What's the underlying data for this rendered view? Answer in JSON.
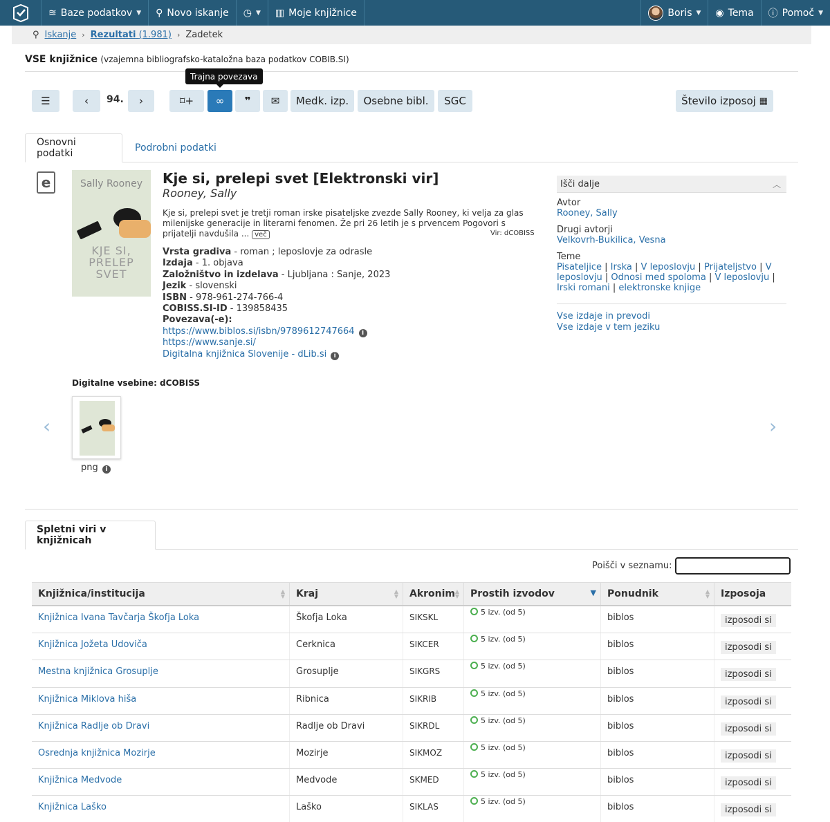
{
  "nav": {
    "databases": "Baze podatkov",
    "new_search": "Novo iskanje",
    "my_libraries": "Moje knjižnice",
    "user": "Boris",
    "theme": "Tema",
    "help": "Pomoč"
  },
  "breadcrumb": {
    "search": "Iskanje",
    "results": "Rezultati",
    "results_count": "(1.981)",
    "current": "Zadetek"
  },
  "db": {
    "name": "VSE knjižnice",
    "subtitle": "(vzajemna bibliografsko-kataložna baza podatkov COBIB.SI)"
  },
  "toolbar": {
    "position": "94.",
    "tooltip": "Trajna povezava",
    "medk": "Medk. izp.",
    "osebne": "Osebne bibl.",
    "sgc": "SGC",
    "loans": "Število izposoj"
  },
  "tabs": {
    "basic": "Osnovni podatki",
    "detailed": "Podrobni podatki",
    "online": "Spletni viri v knjižnicah"
  },
  "record": {
    "title": "Kje si, prelepi svet [Elektronski vir]",
    "author": "Rooney, Sally",
    "description": "Kje si, prelepi svet je tretji roman irske pisateljske zvezde Sally Rooney, ki velja za glas milenijske generacije in literarni fenomen. Že pri 26 letih je s prvencem Pogovori s prijatelji navdušila ...",
    "more": "več",
    "source": "Vir: dCOBISS",
    "cover_top": "Sally Rooney",
    "cover_line1": "KJE SI,",
    "cover_line2": "PRELEP",
    "cover_line3": "SVET",
    "fields": [
      {
        "label": "Vrsta gradiva",
        "value": "roman ; leposlovje za odrasle"
      },
      {
        "label": "Izdaja",
        "value": "1. objava"
      },
      {
        "label": "Založništvo in izdelava",
        "value": "Ljubljana : Sanje, 2023"
      },
      {
        "label": "Jezik",
        "value": "slovenski"
      },
      {
        "label": "ISBN",
        "value": "978-961-274-766-4"
      },
      {
        "label": "COBISS.SI-ID",
        "value": "139858435"
      }
    ],
    "links_label": "Povezava(-e):",
    "links": [
      "https://www.biblos.si/isbn/9789612747664",
      "https://www.sanje.si/",
      "Digitalna knjižnica Slovenije - dLib.si"
    ],
    "field_sep": "-"
  },
  "side": {
    "header": "Išči dalje",
    "author_label": "Avtor",
    "author": "Rooney, Sally",
    "other_label": "Drugi avtorji",
    "other": "Velkovrh-Bukilica, Vesna",
    "topics_label": "Teme",
    "topics": [
      "Pisateljice",
      "Irska",
      "V leposlovju",
      "Prijateljstvo",
      "V leposlovju",
      "Odnosi med spoloma",
      "V leposlovju",
      "Irski romani",
      "elektronske knjige"
    ],
    "all_editions": "Vse izdaje in prevodi",
    "lang_editions": "Vse izdaje v tem jeziku"
  },
  "digital": {
    "label": "Digitalne vsebine: dCOBISS",
    "format": "png"
  },
  "table": {
    "search_label": "Poišči v seznamu:",
    "headers": [
      "Knjižnica/institucija",
      "Kraj",
      "Akronim",
      "Prostih izvodov",
      "Ponudnik",
      "Izposoja"
    ],
    "rows": [
      {
        "library": "Knjižnica Ivana Tavčarja Škofja Loka",
        "place": "Škofja Loka",
        "code": "SIKSKL",
        "free": "5 izv. (od 5)",
        "provider": "biblos",
        "action": "izposodi si"
      },
      {
        "library": "Knjižnica Jožeta Udoviča",
        "place": "Cerknica",
        "code": "SIKCER",
        "free": "5 izv. (od 5)",
        "provider": "biblos",
        "action": "izposodi si"
      },
      {
        "library": "Mestna knjižnica Grosuplje",
        "place": "Grosuplje",
        "code": "SIKGRS",
        "free": "5 izv. (od 5)",
        "provider": "biblos",
        "action": "izposodi si"
      },
      {
        "library": "Knjižnica Miklova hiša",
        "place": "Ribnica",
        "code": "SIKRIB",
        "free": "5 izv. (od 5)",
        "provider": "biblos",
        "action": "izposodi si"
      },
      {
        "library": "Knjižnica Radlje ob Dravi",
        "place": "Radlje ob Dravi",
        "code": "SIKRDL",
        "free": "5 izv. (od 5)",
        "provider": "biblos",
        "action": "izposodi si"
      },
      {
        "library": "Osrednja knjižnica Mozirje",
        "place": "Mozirje",
        "code": "SIKMOZ",
        "free": "5 izv. (od 5)",
        "provider": "biblos",
        "action": "izposodi si"
      },
      {
        "library": "Knjižnica Medvode",
        "place": "Medvode",
        "code": "SKMED",
        "free": "5 izv. (od 5)",
        "provider": "biblos",
        "action": "izposodi si"
      },
      {
        "library": "Knjižnica Laško",
        "place": "Laško",
        "code": "SIKLAS",
        "free": "5 izv. (od 5)",
        "provider": "biblos",
        "action": "izposodi si"
      }
    ]
  },
  "colors": {
    "nav": "#265a78",
    "accent": "#2a7ab8",
    "link": "#2a6fa8",
    "button": "#dbe7ef",
    "available": "#4caf50"
  }
}
